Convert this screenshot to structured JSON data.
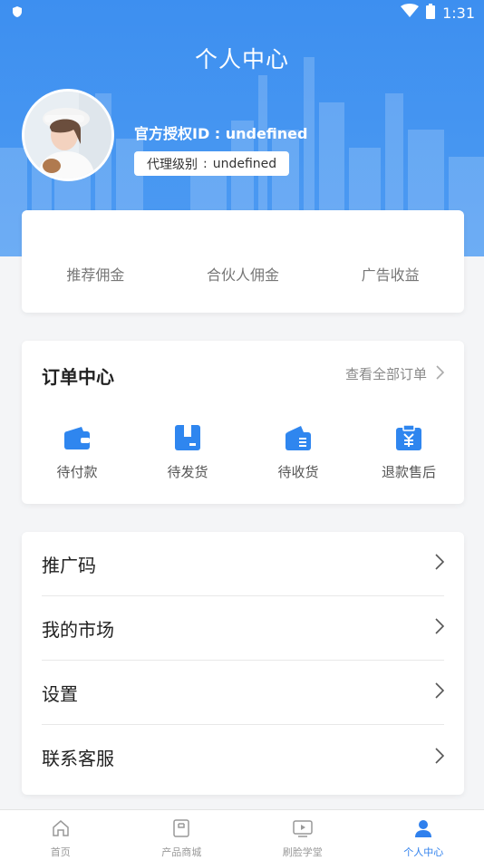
{
  "status_bar": {
    "time": "1:31"
  },
  "header": {
    "title": "个人中心",
    "auth_id": "官方授权ID : undefined",
    "agent_label": "代理级别",
    "agent_sep": ":",
    "agent_value": "undefined"
  },
  "stats": [
    "推荐佣金",
    "合伙人佣金",
    "广告收益"
  ],
  "orders": {
    "title": "订单中心",
    "view_all": "查看全部订单",
    "items": [
      {
        "label": "待付款",
        "icon": "wallet-icon"
      },
      {
        "label": "待发货",
        "icon": "package-icon"
      },
      {
        "label": "待收货",
        "icon": "delivery-icon"
      },
      {
        "label": "退款售后",
        "icon": "refund-icon"
      }
    ]
  },
  "menu": [
    "推广码",
    "我的市场",
    "设置",
    "联系客服"
  ],
  "tabbar": [
    {
      "label": "首页",
      "icon": "home-icon"
    },
    {
      "label": "产品商城",
      "icon": "shop-icon"
    },
    {
      "label": "刷脸学堂",
      "icon": "video-icon"
    },
    {
      "label": "个人中心",
      "icon": "person-icon",
      "active": true
    }
  ],
  "colors": {
    "primary": "#3d8ff0",
    "active_tab": "#2f80ed",
    "icon_blue": "#2f86ef"
  }
}
